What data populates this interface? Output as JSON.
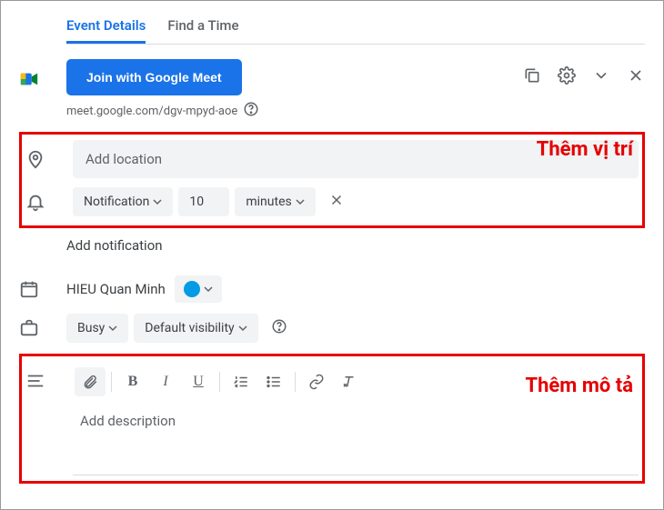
{
  "tabs": {
    "event_details": "Event Details",
    "find_time": "Find a Time"
  },
  "meet": {
    "button_label": "Join with Google Meet",
    "link_text": "meet.google.com/dgv-mpyd-aoe"
  },
  "location": {
    "placeholder": "Add location"
  },
  "notification": {
    "type_label": "Notification",
    "value": "10",
    "unit_label": "minutes",
    "add_label": "Add notification"
  },
  "calendar": {
    "owner_name": "HIEU Quan Minh",
    "color": "#039be5"
  },
  "availability": {
    "busy_label": "Busy",
    "visibility_label": "Default visibility"
  },
  "description": {
    "placeholder": "Add description"
  },
  "annotations": {
    "location": "Thêm vị trí",
    "description": "Thêm mô tả"
  }
}
